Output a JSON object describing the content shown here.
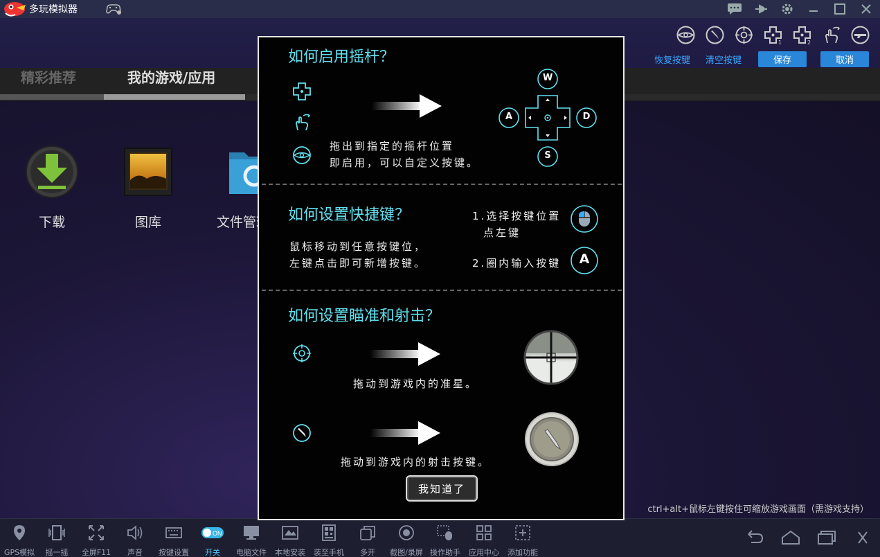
{
  "app": {
    "title": "多玩模拟器"
  },
  "key_toolbar": {
    "icons": [
      "crosshair-ring-icon",
      "bullet-icon",
      "aim-icon",
      "dpad-1-icon",
      "dpad-2-icon",
      "swipe-icon",
      "gun-icon"
    ],
    "dpad_numbers": [
      "1",
      "2"
    ],
    "restore_label": "恢复按键",
    "clear_label": "清空按键",
    "save_label": "保存",
    "cancel_label": "取消"
  },
  "desktop": {
    "tabs": [
      "精彩推荐",
      "我的游戏/应用"
    ],
    "apps": [
      {
        "label": "下载",
        "icon": "download-icon"
      },
      {
        "label": "图库",
        "icon": "gallery-icon"
      },
      {
        "label": "文件管理",
        "icon": "folder-icon"
      }
    ],
    "zoom_hint": "ctrl+alt+鼠标左键按住可缩放游戏画面（需游戏支持）"
  },
  "dialog": {
    "section1": {
      "title": "如何启用摇杆？",
      "line1": "拖出到指定的摇杆位置",
      "line2": "即启用，可以自定义按键。",
      "keys": {
        "up": "W",
        "left": "A",
        "right": "D",
        "down": "S"
      }
    },
    "section2": {
      "title": "如何设置快捷键？",
      "line1": "鼠标移动到任意按键位，",
      "line2": "左键点击即可新增按键。",
      "step1a": "1.选择按键位置",
      "step1b": "点左键",
      "step2": "2.圈内输入按键",
      "key_example": "A"
    },
    "section3": {
      "title": "如何设置瞄准和射击？",
      "aim_text": "拖动到游戏内的准星。",
      "shoot_text": "拖动到游戏内的射击按键。"
    },
    "got_it_label": "我知道了"
  },
  "bottom_bar": {
    "items": [
      {
        "label": "GPS模拟",
        "icon": "location-icon"
      },
      {
        "label": "摇一摇",
        "icon": "shake-icon"
      },
      {
        "label": "全屏F11",
        "icon": "fullscreen-icon"
      },
      {
        "label": "声音",
        "icon": "volume-icon"
      },
      {
        "label": "按键设置",
        "icon": "keyboard-icon"
      },
      {
        "label": "开关",
        "icon": "toggle-icon",
        "toggle_text": "ON"
      },
      {
        "label": "电脑文件",
        "icon": "monitor-icon"
      },
      {
        "label": "本地安装",
        "icon": "apk-icon"
      },
      {
        "label": "装至手机",
        "icon": "qr-icon"
      },
      {
        "label": "多开",
        "icon": "multi-window-icon"
      },
      {
        "label": "截图/录屏",
        "icon": "record-icon"
      },
      {
        "label": "操作助手",
        "icon": "assistant-icon"
      },
      {
        "label": "应用中心",
        "icon": "app-center-icon"
      },
      {
        "label": "添加功能",
        "icon": "add-feature-icon"
      }
    ]
  },
  "colors": {
    "accent": "#62e0f0",
    "link": "#3aa8ff",
    "button": "#2a86d8",
    "toggle": "#3ab4e6"
  }
}
